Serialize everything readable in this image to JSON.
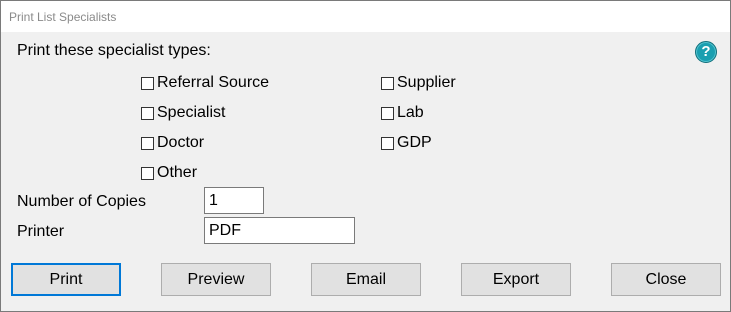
{
  "window": {
    "title": "Print List Specialists"
  },
  "form": {
    "heading": "Print these specialist types:",
    "help_label": "?",
    "types_left": [
      {
        "label": "Referral Source",
        "checked": false
      },
      {
        "label": "Specialist",
        "checked": false
      },
      {
        "label": "Doctor",
        "checked": false
      },
      {
        "label": "Other",
        "checked": false
      }
    ],
    "types_right": [
      {
        "label": "Supplier",
        "checked": false
      },
      {
        "label": "Lab",
        "checked": false
      },
      {
        "label": "GDP",
        "checked": false
      }
    ],
    "copies": {
      "label": "Number of Copies",
      "value": "1"
    },
    "printer": {
      "label": "Printer",
      "value": "PDF"
    }
  },
  "buttons": {
    "print": "Print",
    "preview": "Preview",
    "email": "Email",
    "export": "Export",
    "close": "Close"
  },
  "icons": {
    "help": "help-icon",
    "checkbox": "checkbox-unchecked"
  },
  "colors": {
    "dialog_bg": "#f0f0f0",
    "help_accent": "#1a9fb0",
    "default_button_border": "#0078d7"
  }
}
